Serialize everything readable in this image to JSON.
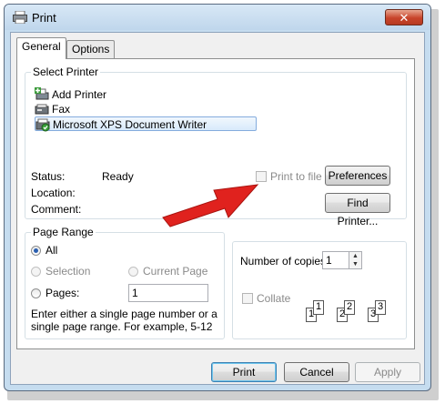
{
  "window": {
    "title": "Print",
    "close": "✕"
  },
  "tabs": [
    {
      "label": "General"
    },
    {
      "label": "Options"
    }
  ],
  "select_printer": {
    "label": "Select Printer",
    "printers": [
      {
        "name": "Add Printer",
        "icon": "add-printer-icon"
      },
      {
        "name": "Fax",
        "icon": "fax-icon"
      },
      {
        "name": "Microsoft XPS Document Writer",
        "icon": "printer-default-icon",
        "selected": true
      }
    ],
    "status_label": "Status:",
    "status_value": "Ready",
    "location_label": "Location:",
    "comment_label": "Comment:",
    "print_to_file": "Print to file",
    "preferences": "Preferences",
    "find_printer": "Find Printer..."
  },
  "page_range": {
    "label": "Page Range",
    "all": "All",
    "selection": "Selection",
    "current_page": "Current Page",
    "pages": "Pages:",
    "pages_value": "1",
    "hint": "Enter either a single page number or a single page range.  For example, 5-12",
    "selected_option": "All"
  },
  "copies": {
    "label": "Number of copies:",
    "value": "1",
    "collate": "Collate",
    "collate_pages": [
      "1",
      "1",
      "2",
      "2",
      "3",
      "3"
    ]
  },
  "buttons": {
    "print": "Print",
    "cancel": "Cancel",
    "apply": "Apply"
  },
  "colors": {
    "arrow": "#e0221e",
    "accent": "#2a5fb0"
  }
}
